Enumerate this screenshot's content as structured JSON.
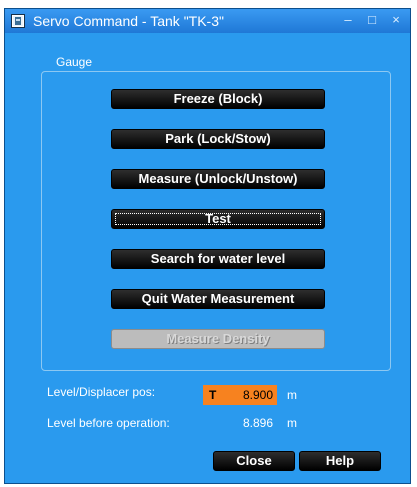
{
  "window": {
    "title": "Servo Command - Tank \"TK-3\"",
    "controls": {
      "minimize": "–",
      "maximize": "□",
      "close": "×"
    }
  },
  "gauge": {
    "group_label": "Gauge",
    "buttons": [
      {
        "label": "Freeze (Block)",
        "state": "normal"
      },
      {
        "label": "Park (Lock/Stow)",
        "state": "normal"
      },
      {
        "label": "Measure (Unlock/Unstow)",
        "state": "normal"
      },
      {
        "label": "Test",
        "state": "focused"
      },
      {
        "label": "Search for water level",
        "state": "normal"
      },
      {
        "label": "Quit Water Measurement",
        "state": "normal"
      },
      {
        "label": "Measure Density",
        "state": "disabled"
      }
    ]
  },
  "level": {
    "label": "Level/Displacer pos:",
    "prefix": "T",
    "value": "8.900",
    "unit": "m",
    "highlight_color": "#f7821f"
  },
  "before": {
    "label": "Level before operation:",
    "value": "8.896",
    "unit": "m"
  },
  "footer": {
    "close_label": "Close",
    "help_label": "Help"
  },
  "colors": {
    "window_bg": "#2a9aee",
    "button_bg": "#000000",
    "button_text": "#ffffff"
  }
}
